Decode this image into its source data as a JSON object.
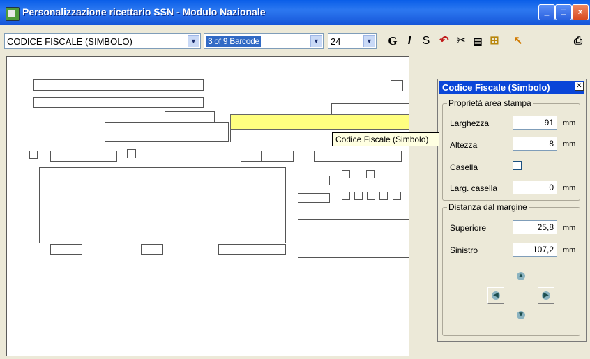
{
  "window": {
    "title": "Personalizzazione ricettario SSN - Modulo Nazionale",
    "controls": [
      "minimize-icon",
      "maximize-icon",
      "close-icon"
    ]
  },
  "toolbar": {
    "field_combo": "CODICE FISCALE (SIMBOLO)",
    "barcode_combo": "3 of 9 Barcode",
    "size_combo": "24",
    "bold_icon": "G",
    "italic_icon": "I",
    "underline_icon": "S",
    "icons": [
      "bold-icon",
      "italic-icon",
      "underline-icon",
      "undo-icon",
      "cut-icon",
      "paste-icon",
      "align-icon",
      "pointer-icon",
      "print-icon"
    ]
  },
  "canvas": {
    "tooltip": "Codice Fiscale (Simbolo)"
  },
  "panel": {
    "title": "Codice Fiscale (Simbolo)",
    "group_print_area": "Proprietà area stampa",
    "width_label": "Larghezza",
    "width_value": "91",
    "height_label": "Altezza",
    "height_value": "8",
    "box_label": "Casella",
    "box_checked": false,
    "box_width_label": "Larg. casella",
    "box_width_value": "0",
    "unit": "mm",
    "group_margin": "Distanza dal margine",
    "top_label": "Superiore",
    "top_value": "25,8",
    "left_label": "Sinistro",
    "left_value": "107,2",
    "arrows": [
      "arrow-up-icon",
      "arrow-left-icon",
      "arrow-right-icon",
      "arrow-down-icon"
    ]
  }
}
